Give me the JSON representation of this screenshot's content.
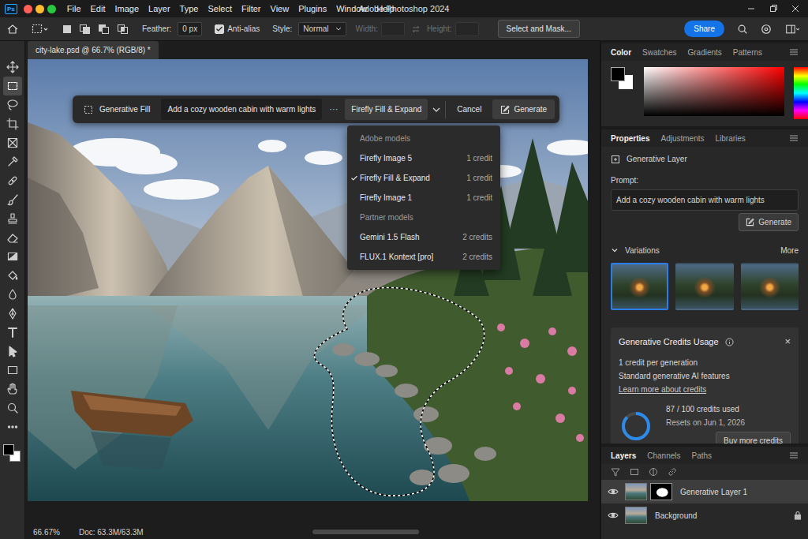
{
  "window": {
    "app_logo": "Ps",
    "title": "Adobe Photoshop 2024"
  },
  "menu": [
    "File",
    "Edit",
    "Image",
    "Layer",
    "Type",
    "Select",
    "Filter",
    "View",
    "Plugins",
    "Window",
    "Help"
  ],
  "options_bar": {
    "feather": {
      "label": "Feather:",
      "value": "0 px"
    },
    "anti_alias": {
      "label": "Anti-alias",
      "checked": true
    },
    "style": {
      "label": "Style:",
      "value": "Normal"
    },
    "width": {
      "label": "Width:",
      "disabled": true
    },
    "height": {
      "label": "Height:",
      "disabled": true
    },
    "select_and_mask": "Select and Mask...",
    "share": "Share"
  },
  "tools": [
    {
      "selected": false
    },
    {
      "selected": true
    },
    {
      "selected": false
    },
    {
      "selected": false
    },
    {
      "selected": false
    },
    {
      "selected": false
    },
    {
      "selected": false
    },
    {
      "selected": false
    },
    {
      "selected": false
    },
    {
      "selected": false
    },
    {
      "selected": false
    },
    {
      "selected": false
    },
    {
      "selected": false
    },
    {
      "selected": false
    },
    {
      "selected": false
    },
    {
      "selected": false
    },
    {
      "selected": false
    },
    {
      "selected": false
    },
    {
      "selected": false
    }
  ],
  "document": {
    "tab": "city-lake.psd @ 66.7% (RGB/8) *"
  },
  "task_bar": {
    "mode": "Generative Fill",
    "prompt": "Add a cozy wooden cabin with warm lights",
    "more": "···",
    "model": "Firefly Fill & Expand",
    "cancel": "Cancel",
    "generate": "Generate"
  },
  "model_menu": {
    "open": true,
    "groups": [
      {
        "header": "Adobe models",
        "items": [
          {
            "label": "Firefly Image 5",
            "cost": "1 credit",
            "selected": false
          },
          {
            "label": "Firefly Fill & Expand",
            "cost": "1 credit",
            "selected": true
          },
          {
            "label": "Firefly Image 1",
            "cost": "1 credit",
            "selected": false
          }
        ]
      },
      {
        "header": "Partner models",
        "items": [
          {
            "label": "Gemini 1.5 Flash",
            "cost": "2 credits",
            "selected": false
          },
          {
            "label": "FLUX.1 Kontext [pro]",
            "cost": "2 credits",
            "selected": false
          }
        ]
      }
    ]
  },
  "color_panel": {
    "tabs": [
      {
        "label": "Color",
        "selected": true
      },
      {
        "label": "Swatches",
        "selected": false
      },
      {
        "label": "Gradients",
        "selected": false
      },
      {
        "label": "Patterns",
        "selected": false
      }
    ]
  },
  "properties_panel": {
    "tabs": [
      {
        "label": "Properties",
        "selected": true
      },
      {
        "label": "Adjustments",
        "selected": false
      },
      {
        "label": "Libraries",
        "selected": false
      }
    ],
    "layer_type": "Generative Layer",
    "prompt_label": "Prompt:",
    "prompt": "Add a cozy wooden cabin with warm lights",
    "generate": "Generate",
    "variations": {
      "label": "Variations",
      "expanded": true,
      "more": "More",
      "items": [
        {
          "selected": true
        },
        {
          "selected": false
        },
        {
          "selected": false
        }
      ]
    }
  },
  "credits": {
    "title": "Generative Credits Usage",
    "close": "×",
    "lines": [
      "1 credit per generation",
      "Standard generative AI features"
    ],
    "link": "Learn more about credits",
    "used": "87 / 100 credits used",
    "level": 0.87,
    "resets": "Resets on Jun 1, 2026",
    "buy": "Buy more credits"
  },
  "layers_panel": {
    "tabs": [
      {
        "label": "Layers",
        "selected": true
      },
      {
        "label": "Channels",
        "selected": false
      },
      {
        "label": "Paths",
        "selected": false
      }
    ],
    "layers": [
      {
        "name": "Generative Layer 1",
        "kind": "generative",
        "selected": true,
        "visible": true,
        "locked": false
      },
      {
        "name": "Background",
        "kind": "background",
        "selected": false,
        "visible": true,
        "locked": true
      }
    ]
  },
  "status_bar": {
    "zoom": "66.67%",
    "doc": "Doc: 63.3M/63.3M"
  }
}
